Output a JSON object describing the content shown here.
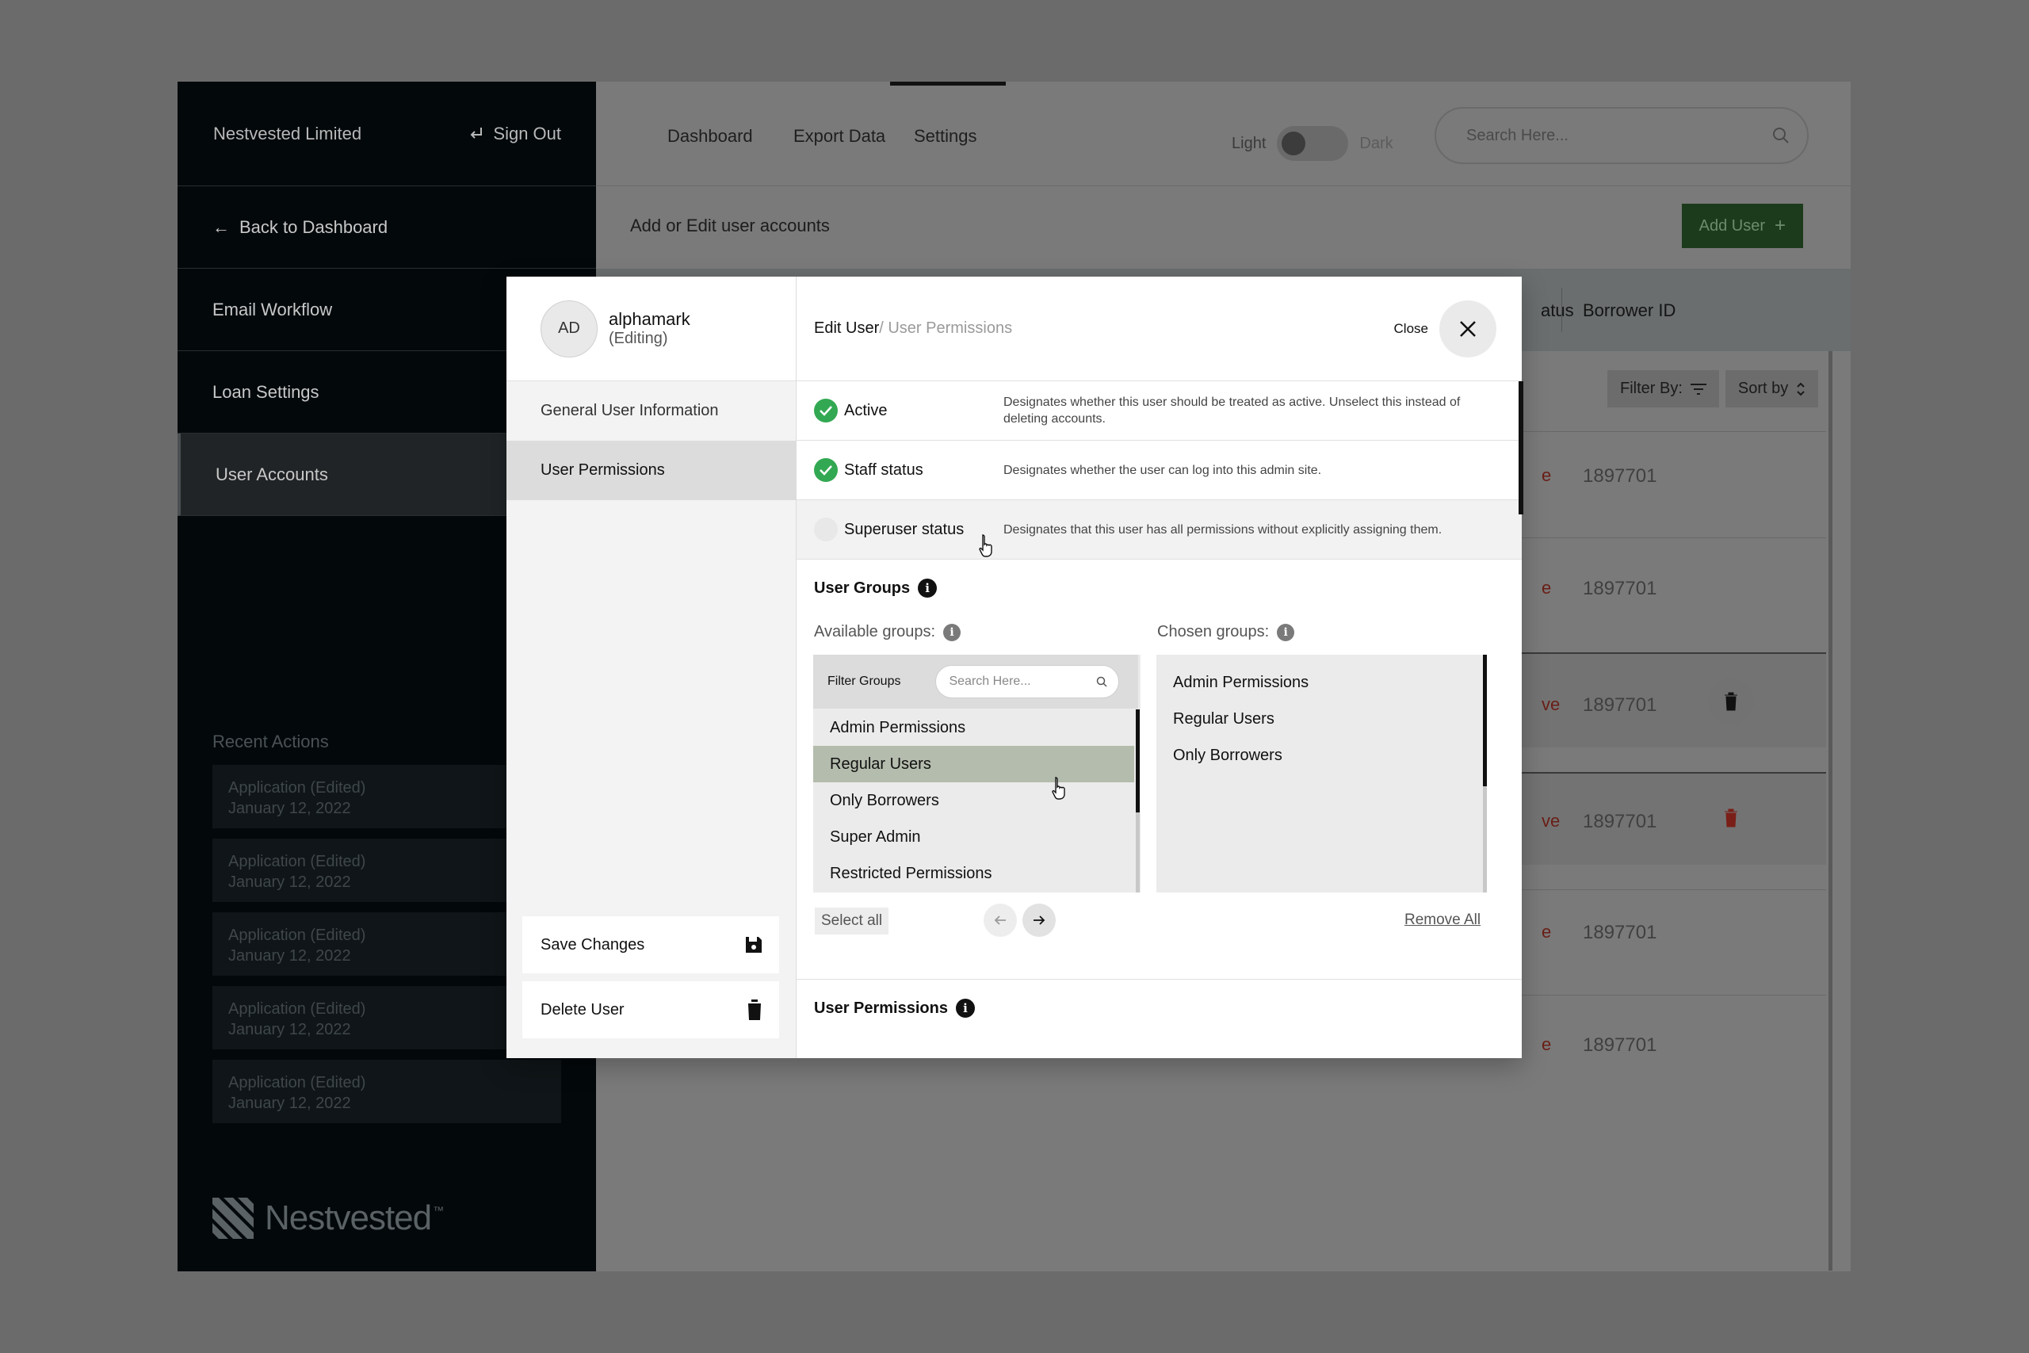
{
  "sidebar": {
    "company": "Nestvested Limited",
    "signout": "Sign Out",
    "items": [
      {
        "label": "Back to Dashboard"
      },
      {
        "label": "Email Workflow"
      },
      {
        "label": "Loan Settings"
      },
      {
        "label": "User Accounts"
      }
    ],
    "recent_title": "Recent Actions",
    "recent": [
      {
        "title": "Application (Edited)",
        "date": "January 12, 2022"
      },
      {
        "title": "Application (Edited)",
        "date": "January 12, 2022"
      },
      {
        "title": "Application (Edited)",
        "date": "January 12, 2022"
      },
      {
        "title": "Application (Edited)",
        "date": "January 12, 2022"
      },
      {
        "title": "Application (Edited)",
        "date": "January 12, 2022"
      }
    ],
    "brand": "Nestvested",
    "brand_mark": "™"
  },
  "topnav": {
    "tabs": [
      "Dashboard",
      "Export Data",
      "Settings"
    ],
    "active_tab": "Settings",
    "theme_light": "Light",
    "theme_dark": "Dark",
    "search_placeholder": "Search Here..."
  },
  "page": {
    "title": "Add or Edit user accounts",
    "add_user": "Add User",
    "columns": {
      "status": "atus",
      "borrower_id": "Borrower ID"
    },
    "filter_by": "Filter By:",
    "sort_by": "Sort by",
    "rows": [
      {
        "status": "e",
        "borrower_id": "1897701"
      },
      {
        "status": "e",
        "borrower_id": "1897701"
      },
      {
        "status": "ve",
        "borrower_id": "1897701"
      },
      {
        "status": "ve",
        "borrower_id": "1897701"
      },
      {
        "status": "e",
        "borrower_id": "1897701"
      },
      {
        "status": "e",
        "borrower_id": "1897701"
      }
    ]
  },
  "modal": {
    "avatar_initials": "AD",
    "username": "alphamark",
    "user_state": "(Editing)",
    "nav": [
      "General User Information",
      "User Permissions"
    ],
    "active_nav": "User Permissions",
    "save": "Save Changes",
    "delete": "Delete User",
    "breadcrumb_main": "Edit User",
    "breadcrumb_sub": "/ User Permissions",
    "close": "Close",
    "permissions": [
      {
        "label": "Active",
        "checked": true,
        "desc": "Designates whether this user should be treated as active. Unselect this instead of deleting accounts."
      },
      {
        "label": "Staff status",
        "checked": true,
        "desc": "Designates whether the user can log into this admin site."
      },
      {
        "label": "Superuser status",
        "checked": false,
        "desc": "Designates that this user has all permissions without explicitly assigning them."
      }
    ],
    "user_groups_title": "User Groups",
    "available_label": "Available groups:",
    "chosen_label": "Chosen groups:",
    "filter_label": "Filter Groups",
    "filter_placeholder": "Search Here...",
    "available_groups": [
      "Admin Permissions",
      "Regular Users",
      "Only Borrowers",
      "Super Admin",
      "Restricted Permissions"
    ],
    "selected_available": "Regular Users",
    "chosen_groups": [
      "Admin Permissions",
      "Regular Users",
      "Only Borrowers"
    ],
    "select_all": "Select all",
    "remove_all": "Remove All",
    "user_permissions_title": "User Permissions"
  },
  "colors": {
    "check": "#33a852",
    "accent_dark": "#03080b",
    "selected_row": "#b4bcad",
    "danger": "#b3261e"
  }
}
